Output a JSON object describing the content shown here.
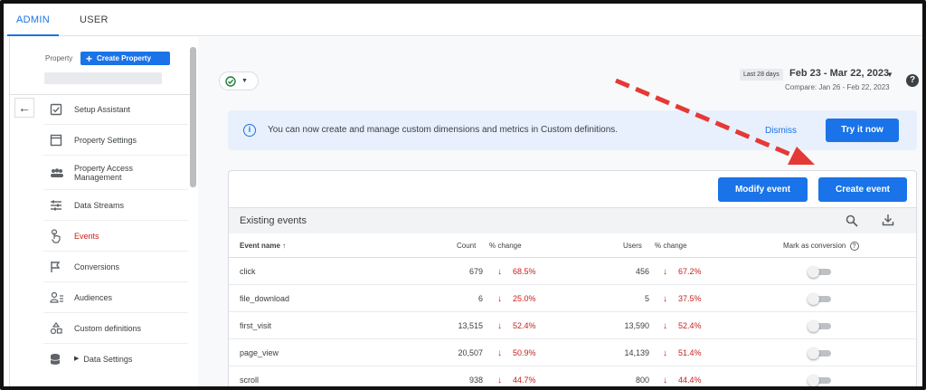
{
  "tabs": [
    {
      "label": "ADMIN",
      "active": true
    },
    {
      "label": "USER",
      "active": false
    }
  ],
  "sidebar": {
    "property_label": "Property",
    "create_property_label": "Create Property",
    "items": [
      {
        "label": "Setup Assistant",
        "icon": "checkbox-icon"
      },
      {
        "label": "Property Settings",
        "icon": "window-icon"
      },
      {
        "label": "Property Access Management",
        "icon": "people-icon"
      },
      {
        "label": "Data Streams",
        "icon": "streams-icon"
      },
      {
        "label": "Events",
        "icon": "touch-icon",
        "active": true
      },
      {
        "label": "Conversions",
        "icon": "flag-icon"
      },
      {
        "label": "Audiences",
        "icon": "audience-icon"
      },
      {
        "label": "Custom definitions",
        "icon": "shapes-icon"
      },
      {
        "label": "Data Settings",
        "icon": "database-icon"
      }
    ]
  },
  "header": {
    "date_chip": "Last 28 days",
    "date_range": "Feb 23 - Mar 22, 2023",
    "compare": "Compare: Jan 26 - Feb 22, 2023",
    "help": "?"
  },
  "banner": {
    "info_glyph": "i",
    "text": "You can now create and manage custom dimensions and metrics in Custom definitions.",
    "dismiss": "Dismiss",
    "try_label": "Try it now"
  },
  "events_card": {
    "modify_label": "Modify event",
    "create_label": "Create event",
    "title": "Existing events",
    "columns": {
      "event_name": "Event name",
      "count": "Count",
      "count_change": "% change",
      "users": "Users",
      "users_change": "% change",
      "conversion": "Mark as conversion"
    },
    "rows": [
      {
        "name": "click",
        "count": "679",
        "count_change": "68.5%",
        "users": "456",
        "users_change": "67.2%"
      },
      {
        "name": "file_download",
        "count": "6",
        "count_change": "25.0%",
        "users": "5",
        "users_change": "37.5%"
      },
      {
        "name": "first_visit",
        "count": "13,515",
        "count_change": "52.4%",
        "users": "13,590",
        "users_change": "52.4%"
      },
      {
        "name": "page_view",
        "count": "20,507",
        "count_change": "50.9%",
        "users": "14,139",
        "users_change": "51.4%"
      },
      {
        "name": "scroll",
        "count": "938",
        "count_change": "44.7%",
        "users": "800",
        "users_change": "44.4%"
      }
    ]
  },
  "colors": {
    "accent": "#1a73e8",
    "decrease": "#c5221f",
    "annotation_arrow": "#e53935"
  }
}
